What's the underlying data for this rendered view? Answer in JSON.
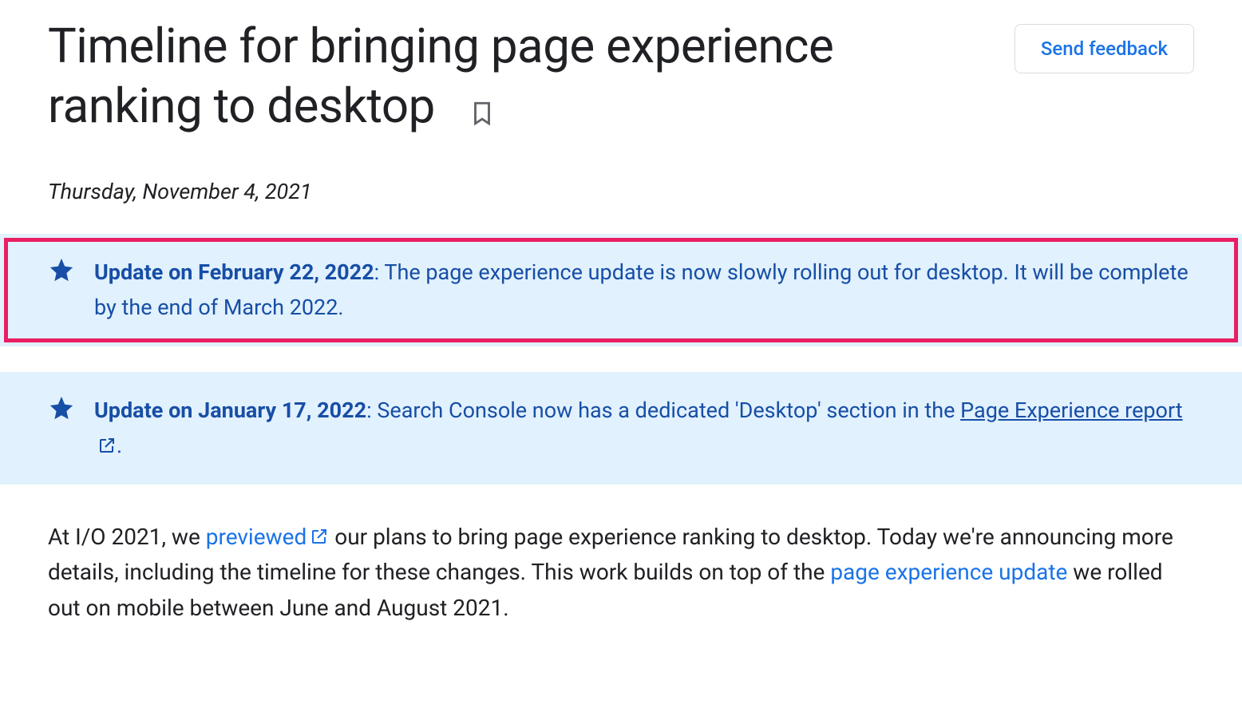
{
  "header": {
    "title": "Timeline for bringing page experience ranking to desktop",
    "feedback_label": "Send feedback"
  },
  "meta": {
    "date": "Thursday, November 4, 2021"
  },
  "callouts": [
    {
      "label": "Update on February 22, 2022",
      "text": ": The page experience update is now slowly rolling out for desktop. It will be complete by the end of March 2022.",
      "highlighted": true
    },
    {
      "label": "Update on January 17, 2022",
      "text_before_link": ": Search Console now has a dedicated 'Desktop' section in the ",
      "link_text": "Page Experience report",
      "text_after_link": ".",
      "highlighted": false
    }
  ],
  "body": {
    "seg1": "At I/O 2021, we ",
    "link1": "previewed",
    "seg2": " our plans to bring page experience ranking to desktop. Today we're announcing more details, including the timeline for these changes. This work builds on top of the ",
    "link2": "page experience update",
    "seg3": " we rolled out on mobile between June and August 2021."
  }
}
